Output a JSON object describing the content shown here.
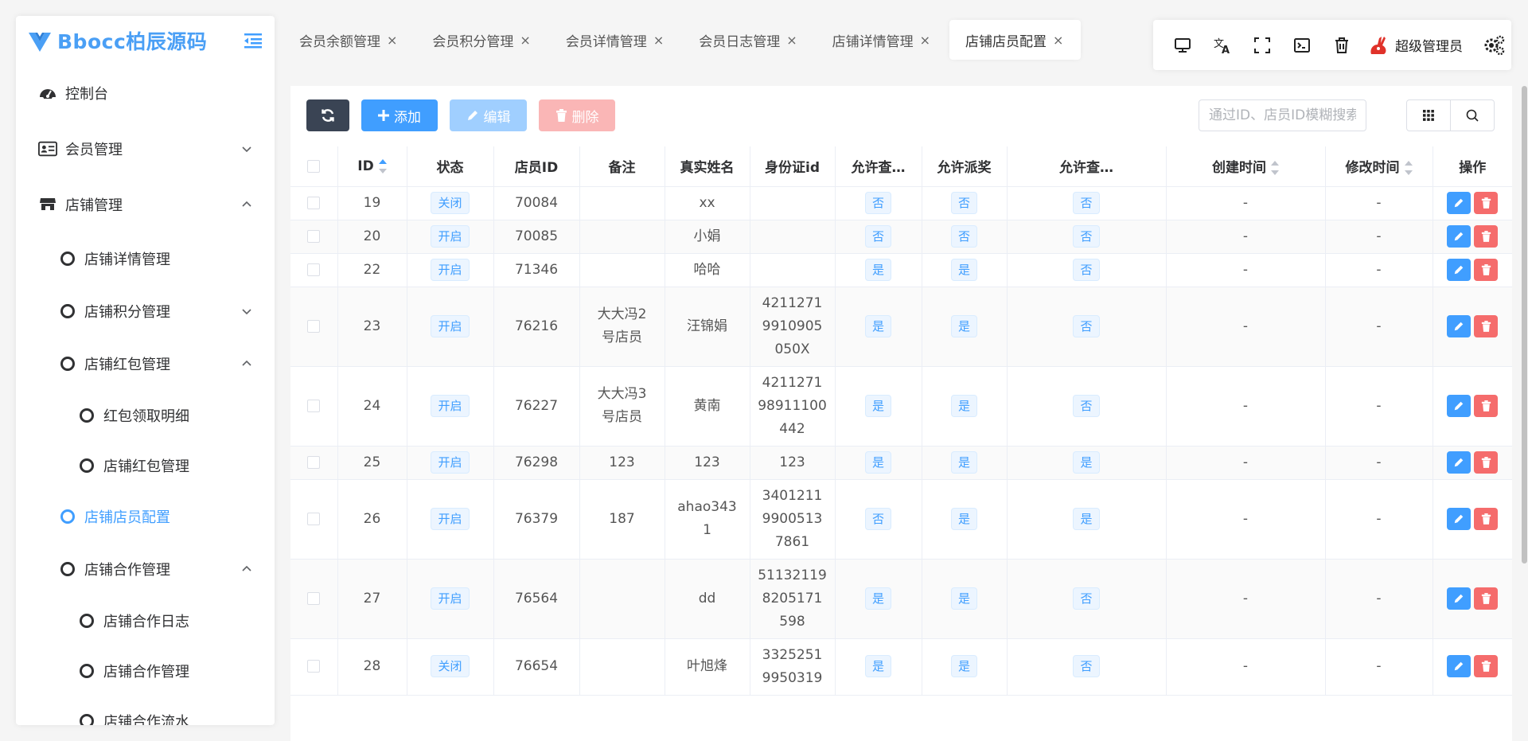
{
  "app": {
    "logo_text": "Bbocc柏辰源码"
  },
  "sidebar": {
    "items": [
      {
        "label": "控制台",
        "level": 1,
        "icon": "dashboard-icon"
      },
      {
        "label": "会员管理",
        "level": 1,
        "icon": "id-card-icon",
        "arrow": "down"
      },
      {
        "label": "店铺管理",
        "level": 1,
        "icon": "shop-icon",
        "arrow": "up"
      },
      {
        "label": "店铺详情管理",
        "level": 2
      },
      {
        "label": "店铺积分管理",
        "level": 2,
        "arrow": "down"
      },
      {
        "label": "店铺红包管理",
        "level": 2,
        "arrow": "up"
      },
      {
        "label": "红包领取明细",
        "level": 3
      },
      {
        "label": "店铺红包管理",
        "level": 3
      },
      {
        "label": "店铺店员配置",
        "level": 2,
        "active": true
      },
      {
        "label": "店铺合作管理",
        "level": 2,
        "arrow": "up"
      },
      {
        "label": "店铺合作日志",
        "level": 3
      },
      {
        "label": "店铺合作管理",
        "level": 3
      },
      {
        "label": "店铺合作流水",
        "level": 3
      }
    ]
  },
  "tabs": [
    {
      "label": "会员余额管理"
    },
    {
      "label": "会员积分管理"
    },
    {
      "label": "会员详情管理"
    },
    {
      "label": "会员日志管理"
    },
    {
      "label": "店铺详情管理"
    },
    {
      "label": "店铺店员配置",
      "active": true
    }
  ],
  "tab_close_glyph": "×",
  "header": {
    "user_name": "超级管理员"
  },
  "toolbar": {
    "add_label": "添加",
    "edit_label": "编辑",
    "delete_label": "删除",
    "search_placeholder": "通过ID、店员ID模糊搜索"
  },
  "table": {
    "columns": [
      "ID",
      "状态",
      "店员ID",
      "备注",
      "真实姓名",
      "身份证id",
      "允许查…",
      "允许派奖",
      "允许查…",
      "创建时间",
      "修改时间",
      "操作"
    ],
    "rows": [
      {
        "id": "19",
        "status": "关闭",
        "clerk_id": "70084",
        "remark": "",
        "name": "xx",
        "id_card": "",
        "a1": "否",
        "a2": "否",
        "a3": "否",
        "created": "-",
        "modified": "-"
      },
      {
        "id": "20",
        "status": "开启",
        "clerk_id": "70085",
        "remark": "",
        "name": "小娟",
        "id_card": "",
        "a1": "否",
        "a2": "否",
        "a3": "否",
        "created": "-",
        "modified": "-"
      },
      {
        "id": "22",
        "status": "开启",
        "clerk_id": "71346",
        "remark": "",
        "name": "哈哈",
        "id_card": "",
        "a1": "是",
        "a2": "是",
        "a3": "否",
        "created": "-",
        "modified": "-"
      },
      {
        "id": "23",
        "status": "开启",
        "clerk_id": "76216",
        "remark": "大大冯2\n号店员",
        "name": "汪锦娟",
        "id_card": "4211271\n9910905\n050X",
        "a1": "是",
        "a2": "是",
        "a3": "否",
        "created": "-",
        "modified": "-"
      },
      {
        "id": "24",
        "status": "开启",
        "clerk_id": "76227",
        "remark": "大大冯3\n号店员",
        "name": "黄南",
        "id_card": "4211271\n98911100\n442",
        "a1": "是",
        "a2": "是",
        "a3": "否",
        "created": "-",
        "modified": "-"
      },
      {
        "id": "25",
        "status": "开启",
        "clerk_id": "76298",
        "remark": "123",
        "name": "123",
        "id_card": "123",
        "a1": "是",
        "a2": "是",
        "a3": "是",
        "created": "-",
        "modified": "-"
      },
      {
        "id": "26",
        "status": "开启",
        "clerk_id": "76379",
        "remark": "187",
        "name": "ahao343\n1",
        "id_card": "3401211\n9900513\n7861",
        "a1": "否",
        "a2": "是",
        "a3": "是",
        "created": "-",
        "modified": "-"
      },
      {
        "id": "27",
        "status": "开启",
        "clerk_id": "76564",
        "remark": "",
        "name": "dd",
        "id_card": "51132119\n8205171\n598",
        "a1": "是",
        "a2": "是",
        "a3": "否",
        "created": "-",
        "modified": "-"
      },
      {
        "id": "28",
        "status": "关闭",
        "clerk_id": "76654",
        "remark": "",
        "name": "叶旭烽",
        "id_card": "3325251\n9950319\n",
        "a1": "是",
        "a2": "是",
        "a3": "否",
        "created": "-",
        "modified": "-"
      }
    ]
  },
  "colors": {
    "primary": "#409eff",
    "danger": "#f56c6c",
    "dark": "#3a4454"
  }
}
